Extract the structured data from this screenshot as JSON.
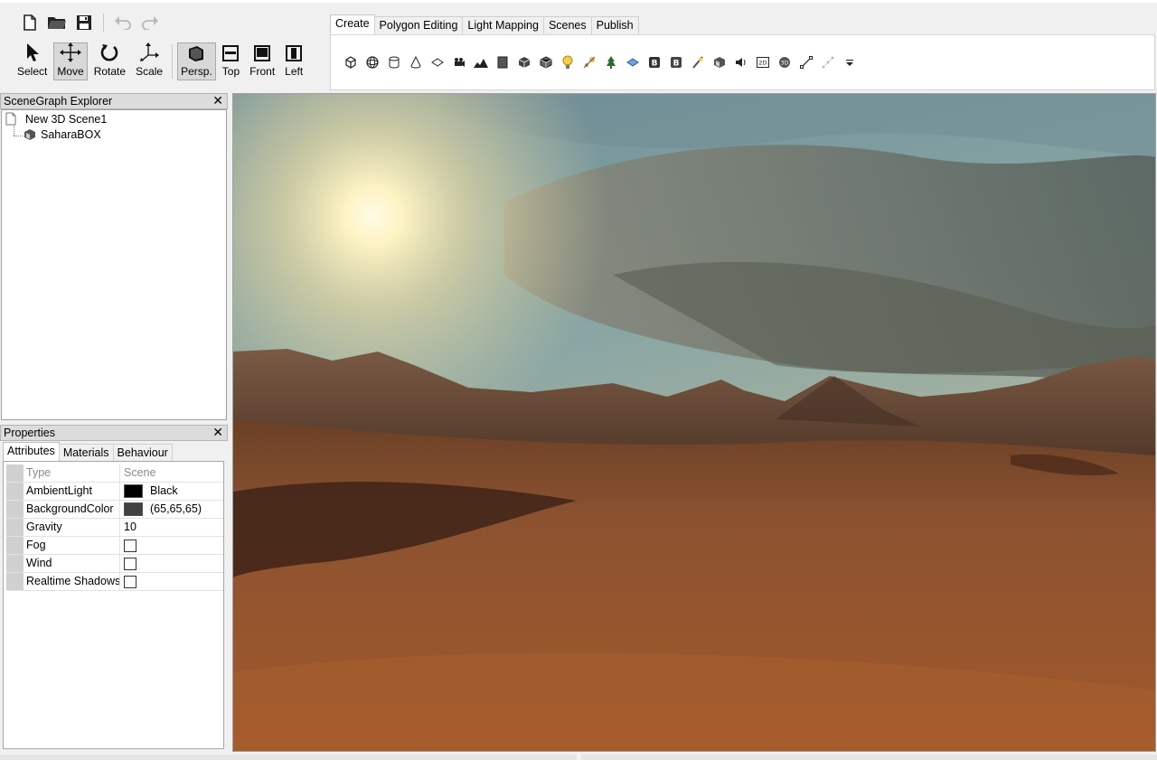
{
  "toolbar": {
    "tools": [
      {
        "label": "Select",
        "icon": "cursor-arrow-icon"
      },
      {
        "label": "Move",
        "icon": "move-arrows-icon"
      },
      {
        "label": "Rotate",
        "icon": "rotate-icon"
      },
      {
        "label": "Scale",
        "icon": "scale-icon"
      }
    ],
    "views": [
      {
        "label": "Persp.",
        "icon": "perspective-view-icon"
      },
      {
        "label": "Top",
        "icon": "top-view-icon"
      },
      {
        "label": "Front",
        "icon": "front-view-icon"
      },
      {
        "label": "Left",
        "icon": "left-view-icon"
      }
    ],
    "active_tool": "Move",
    "active_view": "Persp."
  },
  "ribbon": {
    "tabs": [
      "Create",
      "Polygon Editing",
      "Light Mapping",
      "Scenes",
      "Publish"
    ],
    "active_tab": "Create"
  },
  "scenegraph": {
    "title": "SceneGraph Explorer",
    "root": "New 3D Scene1",
    "child": "SaharaBOX"
  },
  "properties": {
    "title": "Properties",
    "tabs": [
      "Attributes",
      "Materials",
      "Behaviour"
    ],
    "active_tab": "Attributes",
    "header": {
      "name": "Type",
      "value": "Scene"
    },
    "rows": [
      {
        "name": "AmbientLight",
        "value": "Black",
        "swatch": "#000000"
      },
      {
        "name": "BackgroundColor",
        "value": "(65,65,65)",
        "swatch": "#414141"
      },
      {
        "name": "Gravity",
        "value": "10"
      },
      {
        "name": "Fog",
        "checked": false
      },
      {
        "name": "Wind",
        "checked": false
      },
      {
        "name": "Realtime Shadows",
        "checked": false
      }
    ]
  },
  "colors": {
    "accent": "#d8d8d8",
    "sky_top": "#4f6b72",
    "sand": "#9a5a2c"
  }
}
